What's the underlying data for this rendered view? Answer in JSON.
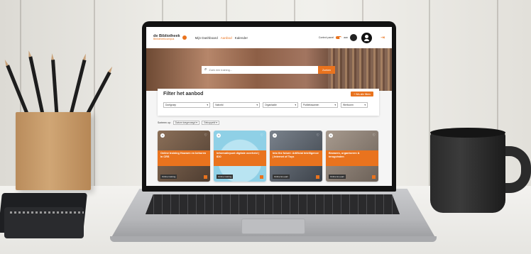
{
  "app": {
    "logo_main": "de Bibliotheek",
    "logo_sub": "Bibliotheekcampus"
  },
  "nav": {
    "items": [
      "Mijn Dashboard",
      "Aanbod",
      "Kalender"
    ],
    "active": "Aanbod"
  },
  "controls": {
    "control_label": "Control panel",
    "toggle_label": "aan"
  },
  "search": {
    "placeholder": "Zoek een training...",
    "button": "Zoeken"
  },
  "filter": {
    "title": "Filter het aanbod",
    "clear_button": "+ Wis alle filters",
    "selects": [
      "Doelgroep",
      "Vakveld",
      "Organisatie",
      "Publiekssamen",
      "Werkvorm"
    ]
  },
  "sort": {
    "label": "Sorteren op:",
    "options": [
      "Datum toegevoegd",
      "Gekoppeld"
    ]
  },
  "cards": [
    {
      "num": "6",
      "title": "Online training Houwen en behoren in CRS",
      "tag": "Online training",
      "bg": "#6e5a48"
    },
    {
      "num": "6",
      "title": "Informatiepunt digitale overheid | IDO",
      "tag": "Online training",
      "bg": "#9fd6e8"
    },
    {
      "num": "6",
      "title": "Into the future: Artificial Intelligence | Internet of Toys",
      "tag": "Online E-Learn",
      "bg": "#59606a"
    },
    {
      "num": "6",
      "title": "Bewaren, organiseren & terugvinden",
      "tag": "Online E-Learn",
      "bg": "#8a7e74"
    }
  ],
  "colors": {
    "accent": "#e9731e",
    "mug": "#2b2b2b",
    "wood_cup": "#c49a6c"
  }
}
